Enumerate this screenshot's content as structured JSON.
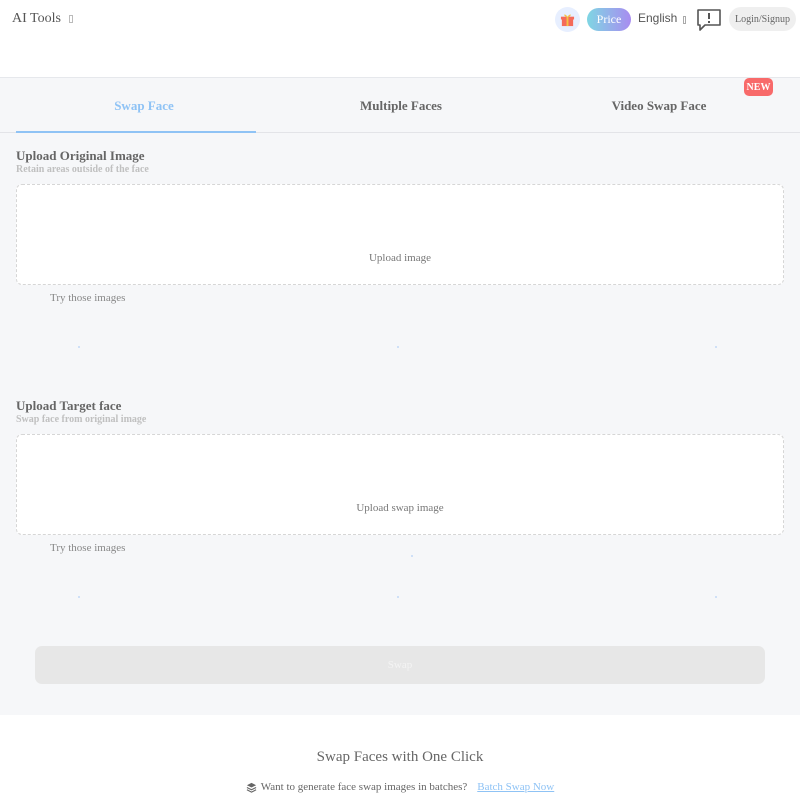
{
  "header": {
    "brand": "AI Tools",
    "price_label": "Price",
    "language": "English",
    "login_label": "Login/Signup"
  },
  "tabs": [
    {
      "label": "Swap Face",
      "active": true
    },
    {
      "label": "Multiple Faces",
      "active": false
    },
    {
      "label": "Video Swap Face",
      "active": false,
      "badge": "NEW"
    }
  ],
  "original": {
    "title": "Upload Original Image",
    "subtitle": "Retain areas outside of the face",
    "upload_label": "Upload image",
    "try_label": "Try those images"
  },
  "target": {
    "title": "Upload Target face",
    "subtitle": "Swap face from original image",
    "upload_label": "Upload swap image",
    "try_label": "Try those images"
  },
  "swap_button": "Swap",
  "bottom": {
    "title": "Swap Faces with One Click",
    "batch_text": "Want to generate face swap images in batches?",
    "batch_link": "Batch Swap Now"
  },
  "colors": {
    "accent": "#8fc3f5",
    "badge": "#f86a6a",
    "price_gradient_start": "#7fd6e3",
    "price_gradient_end": "#a88cf0"
  }
}
